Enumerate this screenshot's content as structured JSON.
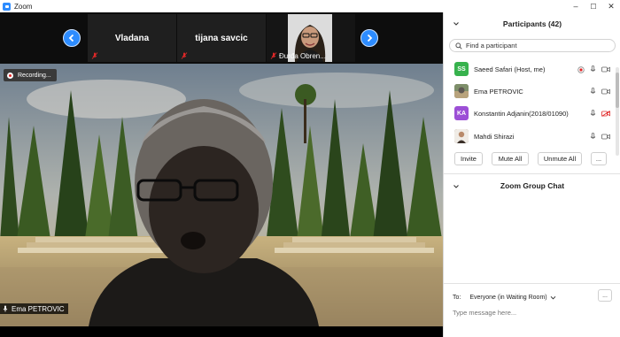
{
  "window": {
    "title": "Zoom",
    "controls": {
      "minimize": "–",
      "maximize": "☐",
      "close": "✕"
    }
  },
  "stage": {
    "thumbnails": [
      {
        "name": "Vladana",
        "muted": true
      },
      {
        "name": "tijana savcic",
        "muted": true
      },
      {
        "name": "Đurđa Obren...",
        "muted": true,
        "has_photo": true
      }
    ],
    "recording_label": "Recording...",
    "active_speaker_name": "Ema PETROVIC"
  },
  "participants": {
    "header": "Participants (42)",
    "search_placeholder": "Find a participant",
    "list": [
      {
        "name": "Saeed Safari (Host, me)",
        "initials": "SS",
        "avatar_color": "#37b24d",
        "recording": true,
        "mic": "on",
        "video": "on"
      },
      {
        "name": "Ema PETROVIC",
        "initials": "",
        "avatar_color": "#8a7a66",
        "recording": false,
        "mic": "on",
        "video": "on"
      },
      {
        "name": "Konstantin Adjanin(2018/01090)",
        "initials": "KA",
        "avatar_color": "#9c4fd6",
        "recording": false,
        "mic": "on",
        "video": "off"
      },
      {
        "name": "Mahdi Shirazi",
        "initials": "",
        "avatar_color": "#6b5140",
        "recording": false,
        "mic": "on",
        "video": "on"
      }
    ],
    "buttons": {
      "invite": "Invite",
      "mute_all": "Mute All",
      "unmute_all": "Unmute All",
      "more": "..."
    }
  },
  "chat": {
    "header": "Zoom Group Chat",
    "to_label": "To:",
    "recipient": "Everyone (in Waiting Room)",
    "more": "...",
    "input_placeholder": "Type message here..."
  },
  "colors": {
    "zoom_blue": "#2d8cff",
    "muted_red": "#e02828",
    "panel_bg": "#ffffff"
  }
}
